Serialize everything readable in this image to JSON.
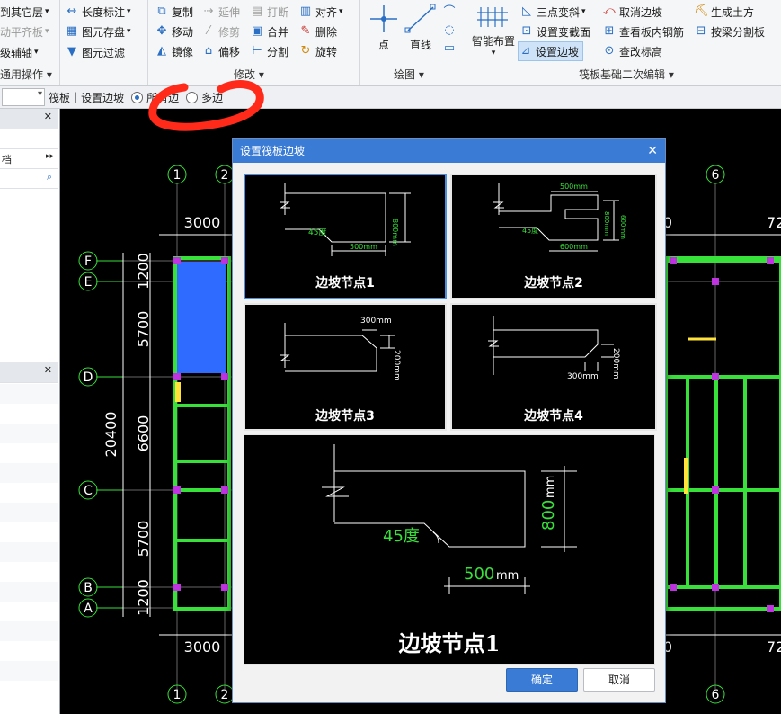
{
  "ribbon": {
    "g1": {
      "items": [
        "到其它层",
        "动平齐板",
        "级辅轴",
        "通用操作"
      ]
    },
    "g2": {
      "items": [
        "长度标注",
        "图元存盘",
        "图元过滤"
      ]
    },
    "modify": {
      "label": "修改",
      "items": [
        "复制",
        "延伸",
        "打断",
        "对齐",
        "移动",
        "修剪",
        "合并",
        "删除",
        "镜像",
        "偏移",
        "分割",
        "旋转"
      ]
    },
    "draw": {
      "label": "绘图",
      "point": "点",
      "line": "直线"
    },
    "raft": {
      "label": "筏板基础二次编辑",
      "smart": "智能布置",
      "items": [
        "三点变斜",
        "取消边坡",
        "生成土方",
        "设置变截面",
        "查看板内钢筋",
        "按梁分割板",
        "设置边坡",
        "查改标高"
      ]
    }
  },
  "cmdbar": {
    "object": "筏板",
    "sep": "|",
    "command": "设置边坡",
    "opt1": "所有边",
    "opt2": "多边"
  },
  "leftpanel": {
    "item1": "档",
    "more": "▸▸"
  },
  "canvas": {
    "axes_top": [
      "1",
      "2",
      "6"
    ],
    "axes_bottom": [
      "1",
      "2",
      "6"
    ],
    "axes_left": [
      "F",
      "E",
      "D",
      "C",
      "B",
      "A"
    ],
    "dims_top": [
      "3000",
      "0",
      "72"
    ],
    "dims_bottom": [
      "3000",
      "0",
      "72"
    ],
    "dims_left": [
      "1200",
      "5700",
      "6600",
      "5700",
      "1200"
    ],
    "total_left": "20400"
  },
  "dialog": {
    "title": "设置筏板边坡",
    "options": [
      {
        "name": "边坡节点1",
        "dims": [
          "800mm",
          "45度",
          "500mm"
        ]
      },
      {
        "name": "边坡节点2",
        "dims": [
          "500mm",
          "800mm",
          "600mm",
          "45度",
          "600mm"
        ]
      },
      {
        "name": "边坡节点3",
        "dims": [
          "300mm",
          "200mm"
        ]
      },
      {
        "name": "边坡节点4",
        "dims": [
          "300mm",
          "200mm"
        ]
      }
    ],
    "preview": {
      "title": "边坡节点1",
      "angle": "45度",
      "width_num": "500",
      "width_unit": "mm",
      "height_num": "800",
      "height_unit": "mm"
    },
    "ok": "确定",
    "cancel": "取消"
  },
  "colors": {
    "accent": "#3a7bd5",
    "cad_green": "#38e03a",
    "cad_blue": "#2f6bff",
    "annotation": "#ff2a1a"
  }
}
